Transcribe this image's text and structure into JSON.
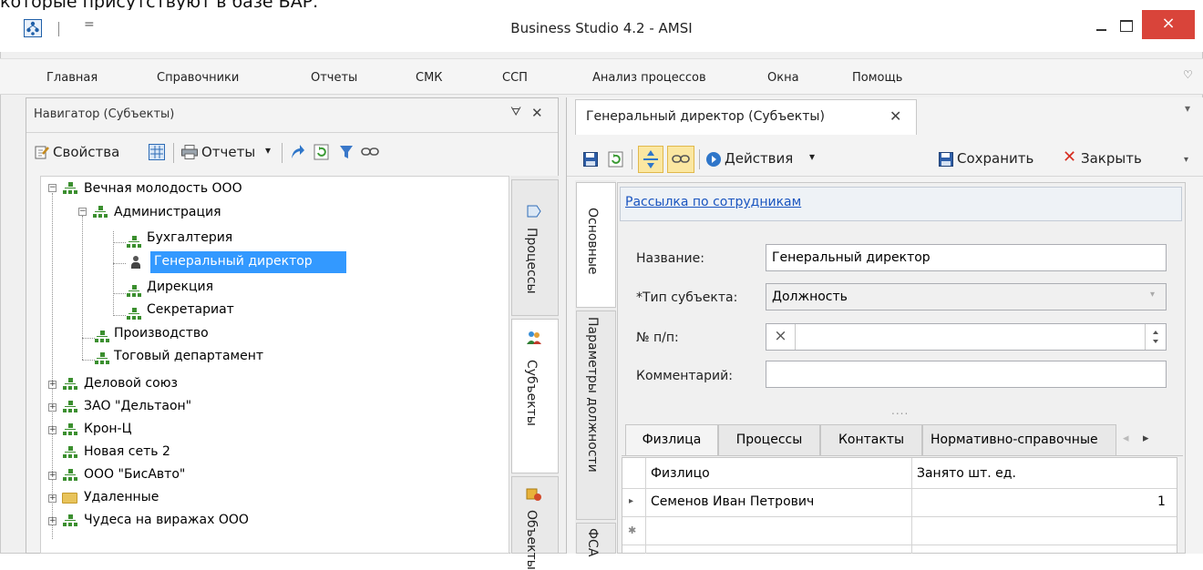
{
  "page": {
    "caption": "которые присутствуют в базе БАР."
  },
  "window": {
    "title": "Business Studio 4.2 - AMSI",
    "quick_access_glyph": "=",
    "close_glyph": "×"
  },
  "menu": {
    "items": [
      "Главная",
      "Справочники",
      "Отчеты",
      "СМК",
      "ССП",
      "Анализ процессов",
      "Окна",
      "Помощь"
    ],
    "chevron_glyph": "♡"
  },
  "navigator": {
    "title": "Навигатор (Субъекты)",
    "pin_glyph": "ᗊ",
    "close_glyph": "✕",
    "toolbar": {
      "properties": "Свойства",
      "reports": "Отчеты",
      "dropdown_glyph": "▾"
    }
  },
  "tree": {
    "root": "Вечная молодость ООО",
    "admin": "Администрация",
    "accounting": "Бухгалтерия",
    "general_director": "Генеральный директор",
    "directorate": "Дирекция",
    "secretariat": "Секретариат",
    "production": "Производство",
    "trade_dept": "Тоговый департамент",
    "business_union": "Деловой союз",
    "deltaon": "ЗАО \"Дельтаон\"",
    "kron": "Крон-Ц",
    "new_net": "Новая сеть 2",
    "bisavto": "ООО \"БисАвто\"",
    "deleted": "Удаленные",
    "chudesa": "Чудеса на виражах ООО"
  },
  "side_tabs": [
    "Процессы",
    "Субъекты",
    "Объекты"
  ],
  "document": {
    "tab_title": "Генеральный директор (Субъекты)",
    "tab_close_glyph": "✕",
    "list_arrow_glyph": "▾",
    "toolbar": {
      "actions": "Действия",
      "save": "Сохранить",
      "close": "Закрыть",
      "close_glyph": "✕",
      "more_glyph": "▾"
    },
    "inner_tabs": [
      "Основные",
      "Параметры должности",
      "ФСА"
    ],
    "link": "Рассылка по сотрудникам",
    "fields": {
      "name_label": "Название:",
      "name_value": "Генеральный директор",
      "type_label": "*Тип субъекта:",
      "type_value": "Должность",
      "num_label": "№ п/п:",
      "num_clear_glyph": "×",
      "comment_label": "Комментарий:"
    },
    "grip": "....",
    "subtabs": [
      "Физлица",
      "Процессы",
      "Контакты",
      "Нормативно-справочные"
    ],
    "subtab_nav": {
      "left": "◂",
      "right": "▸"
    },
    "grid": {
      "columns": [
        "Физлицо",
        "Занято шт. ед."
      ],
      "rows": [
        {
          "person": "Семенов Иван Петрович",
          "units": "1"
        }
      ],
      "row_marker": "▸",
      "new_row_marker": "✱"
    }
  },
  "colors": {
    "selection": "#3399ff",
    "close_button": "#d9443a",
    "link": "#1a55c0",
    "org_icon": "#3b8f2f"
  }
}
